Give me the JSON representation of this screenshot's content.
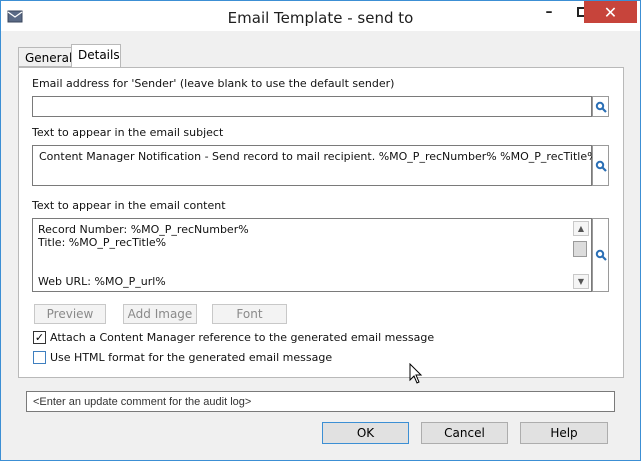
{
  "window": {
    "title": "Email Template - send to",
    "icons": [
      "app-icon",
      "minimize-icon",
      "maximize-icon",
      "close-icon"
    ]
  },
  "tabs": [
    {
      "label": "General",
      "selected": false
    },
    {
      "label": "Details",
      "selected": true
    }
  ],
  "sender": {
    "label": "Email address for 'Sender' (leave blank to use the default sender)",
    "value": ""
  },
  "subject": {
    "label": "Text to appear in the email subject",
    "value": "Content Manager Notification - Send record to mail recipient. %MO_P_recNumber% %MO_P_recTitle%"
  },
  "content": {
    "label": "Text to appear in the email content",
    "lines": [
      "Record Number: %MO_P_recNumber%",
      "Title: %MO_P_recTitle%",
      "",
      "Web URL: %MO_P_url%"
    ]
  },
  "buttons": {
    "preview": "Preview",
    "add_image": "Add Image",
    "font": "Font",
    "ok": "OK",
    "cancel": "Cancel",
    "help": "Help"
  },
  "options": {
    "attach_reference": {
      "label": "Attach a Content Manager reference to the generated email message",
      "checked": true
    },
    "html_format": {
      "label": "Use HTML format for the generated email message",
      "checked": false
    }
  },
  "audit_comment": {
    "value": "<Enter an update comment for the audit log>"
  },
  "colors": {
    "accent": "#3c8fd4",
    "close_button": "#c7443b",
    "search_icon": "#2b6fb5"
  }
}
